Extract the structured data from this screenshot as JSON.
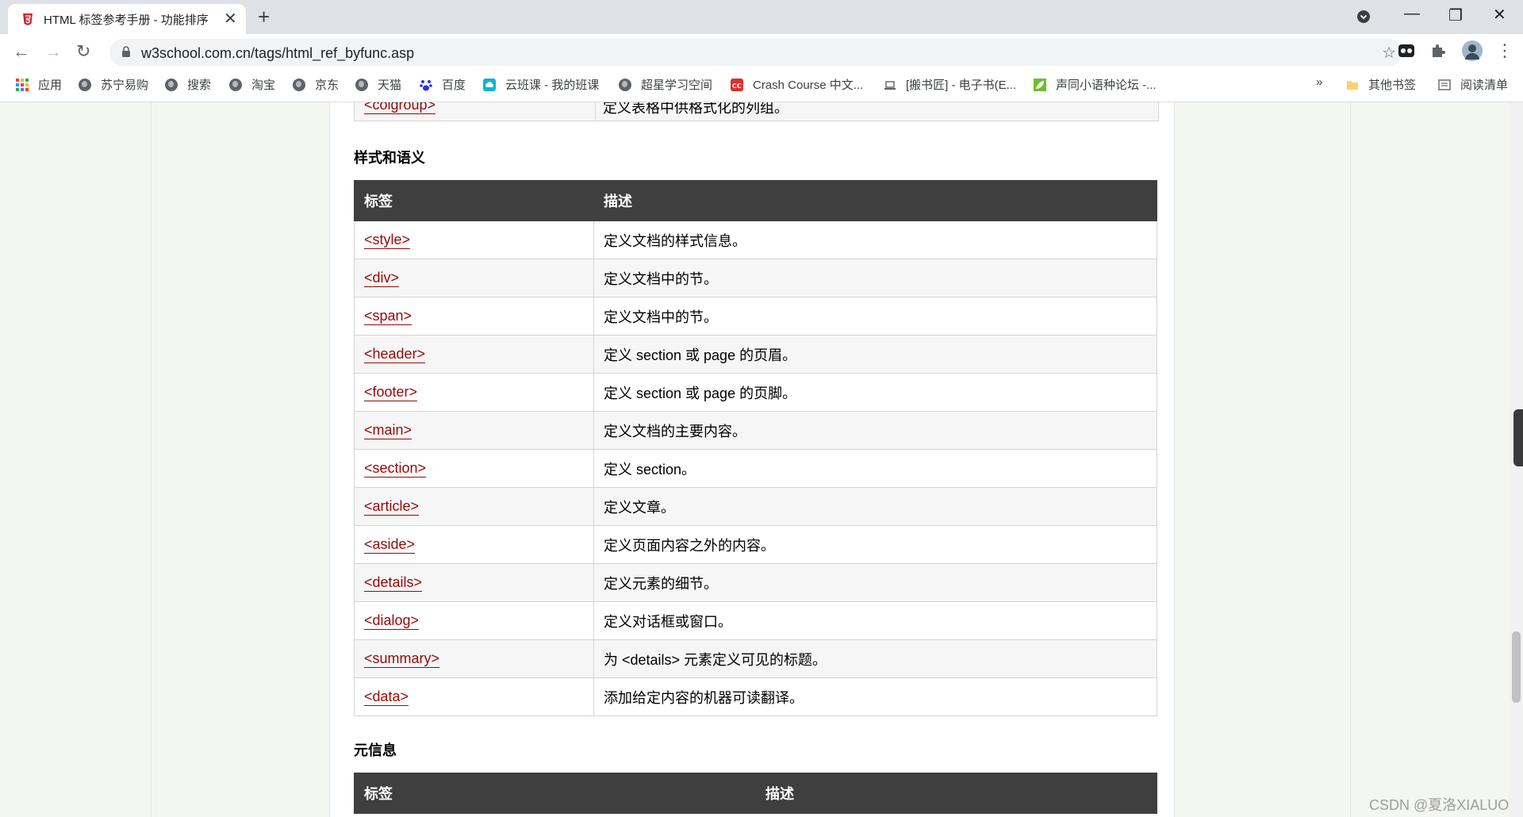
{
  "browser": {
    "tab_title": "HTML 标签参考手册 - 功能排序",
    "url": "w3school.com.cn/tags/html_ref_byfunc.asp",
    "bookmarks": [
      {
        "label": "应用",
        "icon": "apps-grid-icon"
      },
      {
        "label": "苏宁易购",
        "icon": "globe-icon"
      },
      {
        "label": "搜索",
        "icon": "globe-icon"
      },
      {
        "label": "淘宝",
        "icon": "globe-icon"
      },
      {
        "label": "京东",
        "icon": "globe-icon"
      },
      {
        "label": "天猫",
        "icon": "globe-icon"
      },
      {
        "label": "百度",
        "icon": "baidu-paw-icon"
      },
      {
        "label": "云班课 - 我的班课",
        "icon": "cloud-icon"
      },
      {
        "label": "超星学习空间",
        "icon": "globe-icon"
      },
      {
        "label": "Crash Course 中文...",
        "icon": "cc-icon"
      },
      {
        "label": "[搬书匠] - 电子书(E...",
        "icon": "laptop-icon"
      },
      {
        "label": "声同小语种论坛 -...",
        "icon": "leaf-icon"
      }
    ],
    "overflow_label": "»",
    "other_bookmarks": "其他书签",
    "reading_list": "阅读清单"
  },
  "page": {
    "previous_row": {
      "tag": "<colgroup>",
      "desc": "定义表格中供格式化的列组。"
    },
    "sections": [
      {
        "title": "样式和语义",
        "headers": [
          "标签",
          "描述"
        ],
        "rows": [
          {
            "tag": "<style>",
            "desc": "定义文档的样式信息。"
          },
          {
            "tag": "<div>",
            "desc": "定义文档中的节。"
          },
          {
            "tag": "<span>",
            "desc": "定义文档中的节。"
          },
          {
            "tag": "<header>",
            "desc": "定义 section 或 page 的页眉。"
          },
          {
            "tag": "<footer>",
            "desc": "定义 section 或 page 的页脚。"
          },
          {
            "tag": "<main>",
            "desc": "定义文档的主要内容。"
          },
          {
            "tag": "<section>",
            "desc": "定义 section。"
          },
          {
            "tag": "<article>",
            "desc": "定义文章。"
          },
          {
            "tag": "<aside>",
            "desc": "定义页面内容之外的内容。"
          },
          {
            "tag": "<details>",
            "desc": "定义元素的细节。"
          },
          {
            "tag": "<dialog>",
            "desc": "定义对话框或窗口。"
          },
          {
            "tag": "<summary>",
            "desc": "为 <details> 元素定义可见的标题。"
          },
          {
            "tag": "<data>",
            "desc": "添加给定内容的机器可读翻译。"
          }
        ]
      },
      {
        "title": "元信息",
        "headers": [
          "标签",
          "描述"
        ],
        "rows": []
      }
    ]
  },
  "watermark": "CSDN @夏洛XIALUO"
}
